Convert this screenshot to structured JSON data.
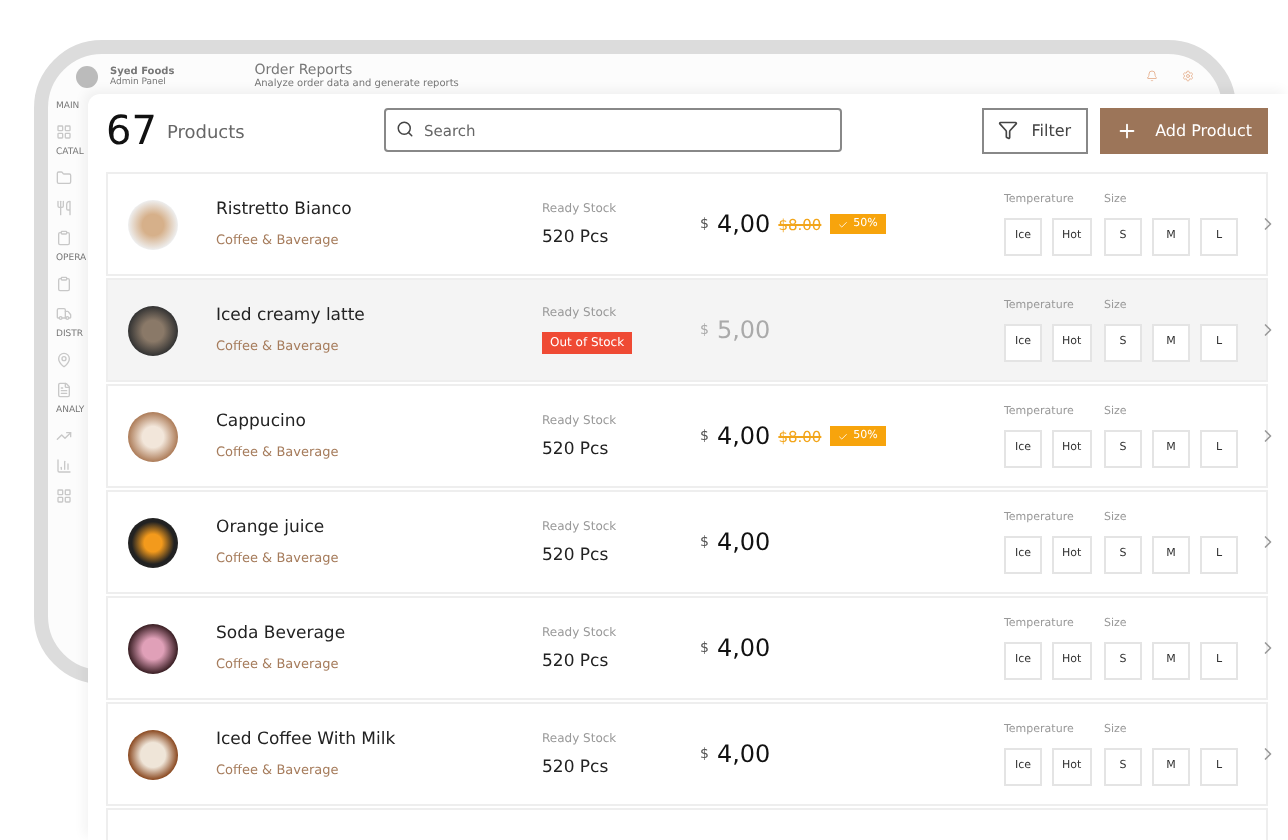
{
  "background_app": {
    "brand": "Syed Foods",
    "brand_subtitle": "Admin Panel",
    "page_title": "Order Reports",
    "page_subtitle": "Analyze order data and generate reports",
    "sidebar_sections": [
      {
        "label": "MAIN"
      },
      {
        "label": "CATAL"
      },
      {
        "label": "OPERA"
      },
      {
        "label": "DISTR"
      },
      {
        "label": "ANALY"
      }
    ]
  },
  "header": {
    "count": "67",
    "count_label": "Products",
    "search": {
      "placeholder": "Search"
    },
    "filter_button": "Filter",
    "add_button": "Add Product"
  },
  "products": [
    {
      "name": "Ristretto Bianco",
      "category": "Coffee & Baverage",
      "available": true,
      "stock": {
        "kind": "count",
        "label": "Ready Stock",
        "value": "520 Pcs"
      },
      "currency": "$",
      "price": "4,00",
      "old_price": "$8.00",
      "discount": "50%",
      "temperature_label": "Temperature",
      "temperatures": [
        "Ice",
        "Hot"
      ],
      "size_label": "Size",
      "sizes": [
        "S",
        "M",
        "L"
      ]
    },
    {
      "name": "Iced creamy latte",
      "category": "Coffee & Baverage",
      "available": false,
      "stock": {
        "kind": "out",
        "label": "Ready Stock",
        "value": "Out of Stock"
      },
      "currency": "$",
      "price": "5,00",
      "temperature_label": "Temperature",
      "temperatures": [
        "Ice",
        "Hot"
      ],
      "size_label": "Size",
      "sizes": [
        "S",
        "M",
        "L"
      ]
    },
    {
      "name": "Cappucino",
      "category": "Coffee & Baverage",
      "available": true,
      "stock": {
        "kind": "count",
        "label": "Ready Stock",
        "value": "520 Pcs"
      },
      "currency": "$",
      "price": "4,00",
      "old_price": "$8.00",
      "discount": "50%",
      "temperature_label": "Temperature",
      "temperatures": [
        "Ice",
        "Hot"
      ],
      "size_label": "Size",
      "sizes": [
        "S",
        "M",
        "L"
      ]
    },
    {
      "name": "Orange juice",
      "category": "Coffee & Baverage",
      "available": true,
      "stock": {
        "kind": "count",
        "label": "Ready Stock",
        "value": "520 Pcs"
      },
      "currency": "$",
      "price": "4,00",
      "temperature_label": "Temperature",
      "temperatures": [
        "Ice",
        "Hot"
      ],
      "size_label": "Size",
      "sizes": [
        "S",
        "M",
        "L"
      ]
    },
    {
      "name": "Soda Beverage",
      "category": "Coffee & Baverage",
      "available": true,
      "stock": {
        "kind": "count",
        "label": "Ready Stock",
        "value": "520 Pcs"
      },
      "currency": "$",
      "price": "4,00",
      "temperature_label": "Temperature",
      "temperatures": [
        "Ice",
        "Hot"
      ],
      "size_label": "Size",
      "sizes": [
        "S",
        "M",
        "L"
      ]
    },
    {
      "name": "Iced Coffee With Milk",
      "category": "Coffee & Baverage",
      "available": true,
      "stock": {
        "kind": "count",
        "label": "Ready Stock",
        "value": "520 Pcs"
      },
      "currency": "$",
      "price": "4,00",
      "temperature_label": "Temperature",
      "temperatures": [
        "Ice",
        "Hot"
      ],
      "size_label": "Size",
      "sizes": [
        "S",
        "M",
        "L"
      ]
    }
  ]
}
